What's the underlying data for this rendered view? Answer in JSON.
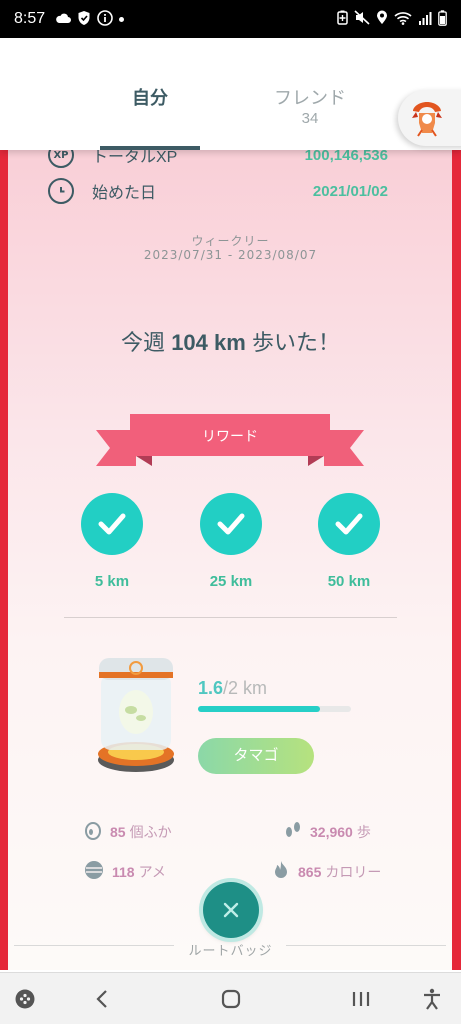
{
  "status_bar": {
    "time": "8:57",
    "left_icons": [
      "cloud-icon",
      "shield-icon",
      "info-icon",
      "dot-icon"
    ],
    "right_icons": [
      "battery-saver-icon",
      "mute-icon",
      "location-icon",
      "wifi-icon",
      "signal-icon",
      "battery-icon"
    ]
  },
  "tabs": {
    "self_label": "自分",
    "friend_label": "フレンド",
    "friend_count": "34"
  },
  "stats_rows": [
    {
      "icon": "XP",
      "label": "トータルXP",
      "value": "100,146,536"
    },
    {
      "icon": "clock-icon",
      "label": "始めた日",
      "value": "2021/01/02"
    }
  ],
  "weekly": {
    "label": "ウィークリー",
    "range": "2023/07/31 - 2023/08/07"
  },
  "walked": {
    "prefix": "今週",
    "distance": "104 km",
    "suffix": "歩いた！"
  },
  "rewards": {
    "title": "リワード",
    "milestones": [
      {
        "label": "5 km",
        "done": true
      },
      {
        "label": "25 km",
        "done": true
      },
      {
        "label": "50 km",
        "done": true
      }
    ]
  },
  "incubator": {
    "current": "1.6",
    "total": "/2 km",
    "progress_fraction": 0.8,
    "button_label": "タマゴ"
  },
  "summary": {
    "hatched_num": "85",
    "hatched_unit": "個ふか",
    "steps_num": "32,960",
    "steps_unit": "歩",
    "candy_num": "118",
    "candy_unit": "アメ",
    "calories_num": "865",
    "calories_unit": "カロリー"
  },
  "route": {
    "label": "ルートバッジ"
  },
  "colors": {
    "accent_teal": "#22cfc4",
    "panel_border": "#e5283a",
    "ribbon": "#f0607a",
    "text_dark": "#3d5b64",
    "value_green": "#4cbf9f"
  }
}
